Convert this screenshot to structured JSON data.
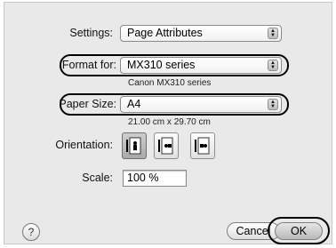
{
  "settings": {
    "label": "Settings:",
    "value": "Page Attributes"
  },
  "format_for": {
    "label": "Format for:",
    "value": "MX310 series",
    "sublabel": "Canon MX310 series"
  },
  "paper_size": {
    "label": "Paper Size:",
    "value": "A4",
    "sublabel": "21.00 cm x 29.70 cm"
  },
  "orientation": {
    "label": "Orientation:",
    "options": [
      "portrait",
      "landscape-left",
      "landscape-right"
    ],
    "selected": "portrait"
  },
  "scale": {
    "label": "Scale:",
    "value": "100 %"
  },
  "help": {
    "glyph": "?"
  },
  "buttons": {
    "cancel": "Cancel",
    "ok": "OK"
  },
  "colors": {
    "dialog_bg": "#e9e9e9",
    "highlight": "#000000"
  }
}
